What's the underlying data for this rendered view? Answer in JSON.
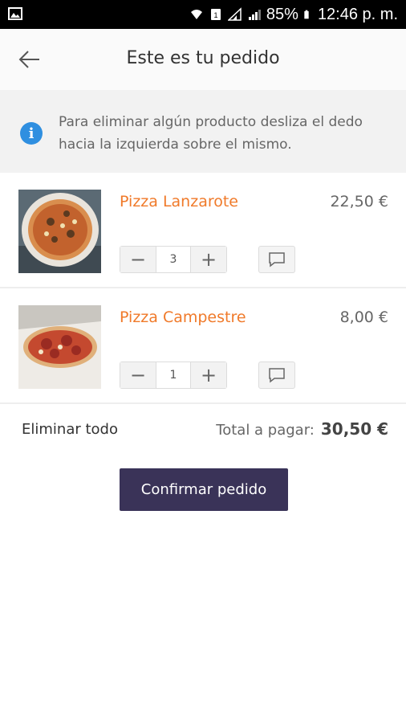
{
  "statusbar": {
    "battery": "85%",
    "time": "12:46 p. m."
  },
  "header": {
    "title": "Este es tu pedido",
    "back_icon": "arrow-left-icon"
  },
  "info": {
    "icon": "info-icon",
    "text": "Para eliminar algún producto desliza el dedo hacia la izquierda sobre el mismo."
  },
  "items": [
    {
      "name": "Pizza Lanzarote",
      "price": "22,50 €",
      "quantity": "3",
      "minus": "−",
      "plus": "+"
    },
    {
      "name": "Pizza Campestre",
      "price": "8,00 €",
      "quantity": "1",
      "minus": "−",
      "plus": "+"
    }
  ],
  "footer": {
    "clear_all": "Eliminar todo",
    "total_label": "Total a pagar:",
    "total_amount": "30,50 €"
  },
  "confirm": {
    "label": "Confirmar pedido"
  },
  "colors": {
    "accent_orange": "#f07a2a",
    "confirm_bg": "#3a3358",
    "info_blue": "#2f8fe0"
  }
}
